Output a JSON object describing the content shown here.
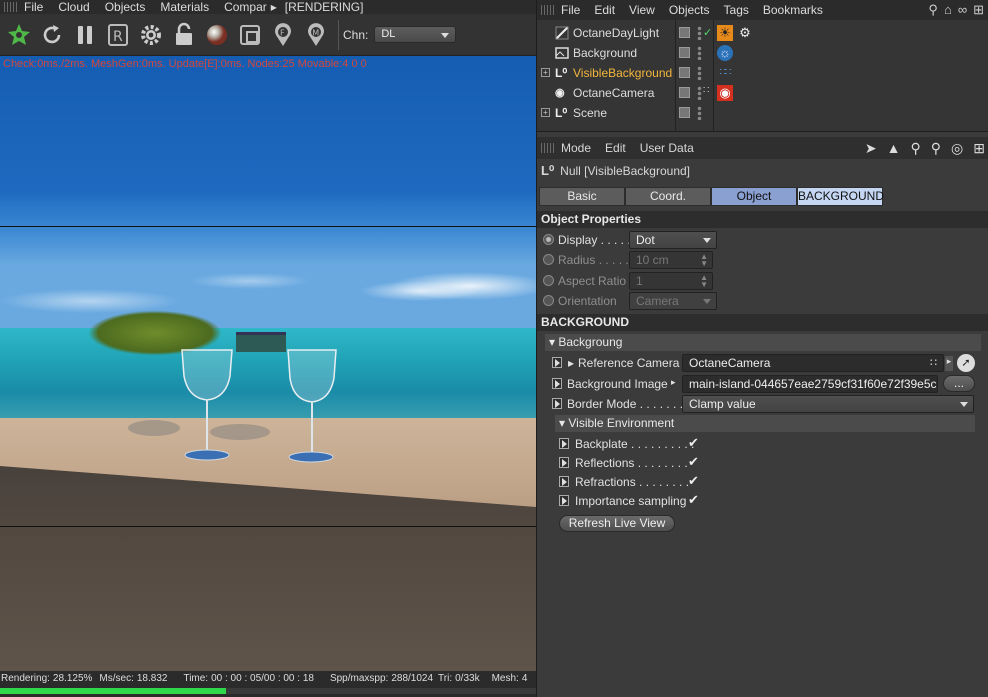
{
  "left_menu": {
    "items": [
      "File",
      "Cloud",
      "Objects",
      "Materials",
      "Compar"
    ],
    "overflow_arrow": "▸",
    "status_tag": "[RENDERING]"
  },
  "toolbar": {
    "icons": [
      "octane-logo-icon",
      "restart-icon",
      "pause-icon",
      "render-region-icon",
      "settings-gear-icon",
      "lock-icon",
      "material-sphere-icon",
      "frame-icon",
      "focus-pin-icon",
      "material-pin-icon"
    ],
    "render_region_letter": "R",
    "pin_f": "F",
    "pin_m": "M",
    "chn_label": "Chn:",
    "chn_value": "DL"
  },
  "viewport": {
    "hud": "Check:0ms./2ms. MeshGen:0ms. Update[E]:0ms. Nodes:25 Movable:4  0 0"
  },
  "statusbar": {
    "rendering_label": "Rendering:",
    "rendering_value": "28.125%",
    "mssec_label": "Ms/sec:",
    "mssec_value": "18.832",
    "time_label": "Time:",
    "time_value": "00 : 00 : 05/00 : 00 : 18",
    "spp_label": "Spp/maxspp:",
    "spp_value": "288/1024",
    "tri_label": "Tri:",
    "tri_value": "0/33k",
    "mesh_label": "Mesh:",
    "mesh_value": "4",
    "progress": 0.421
  },
  "right_menu": {
    "items": [
      "File",
      "Edit",
      "View",
      "Objects",
      "Tags",
      "Bookmarks"
    ]
  },
  "objects": [
    {
      "name": "OctaneDayLight",
      "expand": "",
      "icon": "light",
      "tag": "sun-icon"
    },
    {
      "name": "Background",
      "expand": "",
      "icon": "background",
      "tag": "globe-icon"
    },
    {
      "name": "VisibleBackground",
      "expand": "+",
      "icon": "null",
      "tag": "dotted-tag-icon",
      "selected": true
    },
    {
      "name": "OctaneCamera",
      "expand": "",
      "icon": "camera",
      "tag": "camera-tag-icon"
    },
    {
      "name": "Scene",
      "expand": "+",
      "icon": "null",
      "tag": ""
    }
  ],
  "attr_menu": {
    "items": [
      "Mode",
      "Edit",
      "User Data"
    ]
  },
  "attr": {
    "null_title": "Null [VisibleBackground]",
    "tabs": [
      "Basic",
      "Coord.",
      "Object",
      "BACKGROUND"
    ],
    "object_props_title": "Object Properties",
    "display_label": "Display . . . . .",
    "display_value": "Dot",
    "radius_label": "Radius . . . . .",
    "radius_value": "10 cm",
    "aspect_label": "Aspect Ratio",
    "aspect_value": "1",
    "orientation_label": "Orientation",
    "orientation_value": "Camera",
    "background_title": "BACKGROUND",
    "backgroung_group": "Backgroung",
    "ref_camera_label": "Reference Camera",
    "ref_camera_value": "OctaneCamera",
    "bg_image_label": "Background Image",
    "bg_image_value": "main-island-044657eae2759cf31f60e72f39e5c",
    "bg_image_button": "...",
    "border_mode_label": "Border Mode . . . . . . . .",
    "border_mode_value": "Clamp value",
    "visible_env_group": "Visible Environment",
    "backplate_label": "Backplate  . . . . . . . . . .",
    "reflections_label": "Reflections  . . . . . . . .",
    "refractions_label": "Refractions . . . . . . . .",
    "importance_label": "Importance sampling",
    "checkmark": "✔",
    "refresh_button": "Refresh Live View"
  },
  "colors": {
    "accent_selected": "#f4b63c",
    "hud_red": "#d2483d",
    "progress_green": "#2fd84a",
    "tab_active": "#8aa0d0"
  }
}
